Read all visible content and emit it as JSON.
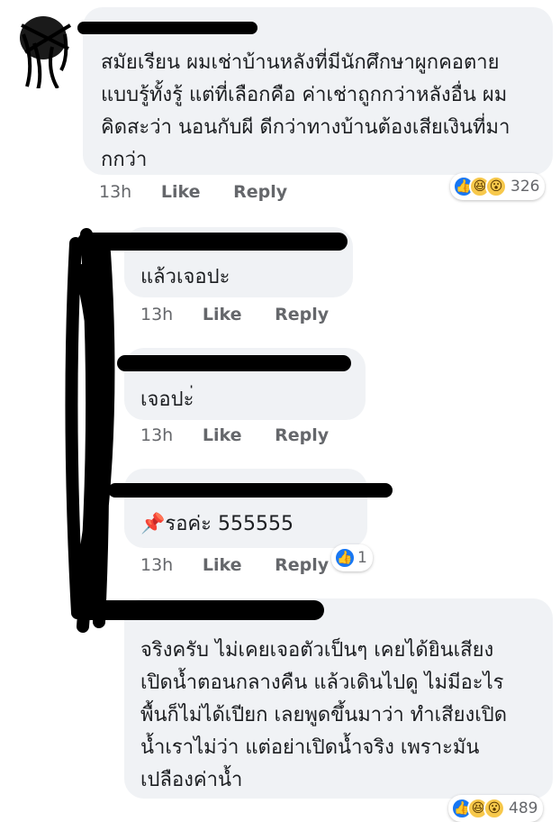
{
  "comments": [
    {
      "text": "สมัยเรียน ผมเช่าบ้านหลังที่มีนักศึกษาผูกคอตาย\nแบบรู้ทั้งรู้ แต่ที่เลือกคือ ค่าเช่าถูกกว่าหลังอื่น ผม\nคิดสะว่า นอนกับผี ดีกว่าทางบ้านต้องเสียเงินที่มา\nกกว่า",
      "time": "13h",
      "like": "Like",
      "reply": "Reply",
      "reactions": {
        "icons": [
          "like-icon",
          "haha-icon",
          "wow-icon"
        ],
        "count": "326"
      }
    },
    {
      "text": "แล้วเจอปะ",
      "time": "13h",
      "like": "Like",
      "reply": "Reply"
    },
    {
      "text": "เจอปะ่",
      "time": "13h",
      "like": "Like",
      "reply": "Reply"
    },
    {
      "text": "รอค่ะ 555555",
      "emoji": "📌",
      "time": "13h",
      "like": "Like",
      "reply": "Reply",
      "reactions": {
        "icons": [
          "like-icon"
        ],
        "count": "1"
      }
    },
    {
      "text": "จริงครับ ไม่เคยเจอตัวเป็นๆ เคยได้ยินเสียง\nเปิดน้ำตอนกลางคืน แล้วเดินไปดู ไม่มีอะไร\nพื้นก็ไม่ได้เปียก เลยพูดขึ้นมาว่า ทำเสียงเปิด\nน้ำเราไม่ว่า แต่อย่าเปิดน้ำจริง เพราะมัน\nเปลืองค่าน้ำ",
      "reactions": {
        "icons": [
          "like-icon",
          "haha-icon",
          "wow-icon"
        ],
        "count": "489"
      }
    }
  ],
  "colors": {
    "bubble": "#f0f2f5",
    "meta": "#65676b",
    "like": "#1877f2",
    "scribble": "#000000"
  }
}
